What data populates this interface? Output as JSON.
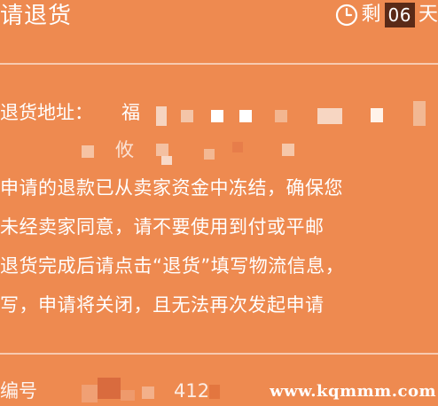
{
  "header": {
    "title": "请退货",
    "countdown_prefix": "剩",
    "countdown_days": "06",
    "countdown_unit": "天",
    "clock_icon": "clock-icon"
  },
  "address": {
    "label": "退货地址：",
    "visible_start": "福",
    "visible_mid": "攸"
  },
  "notice": {
    "lines": [
      "申请的退款已从卖家资金中冻结，确保您",
      "未经卖家同意，请不要使用到付或平邮",
      "退货完成后请点击“退货”填写物流信息，",
      "写，申请将关闭，且无法再次发起申请"
    ]
  },
  "order": {
    "label": "编号",
    "visible_mid": "412"
  },
  "watermark": {
    "text": "www.kqmmm.com"
  },
  "colors": {
    "background": "#ee8a50",
    "countdown_box": "#5a2a17",
    "text": "#ffffff"
  }
}
